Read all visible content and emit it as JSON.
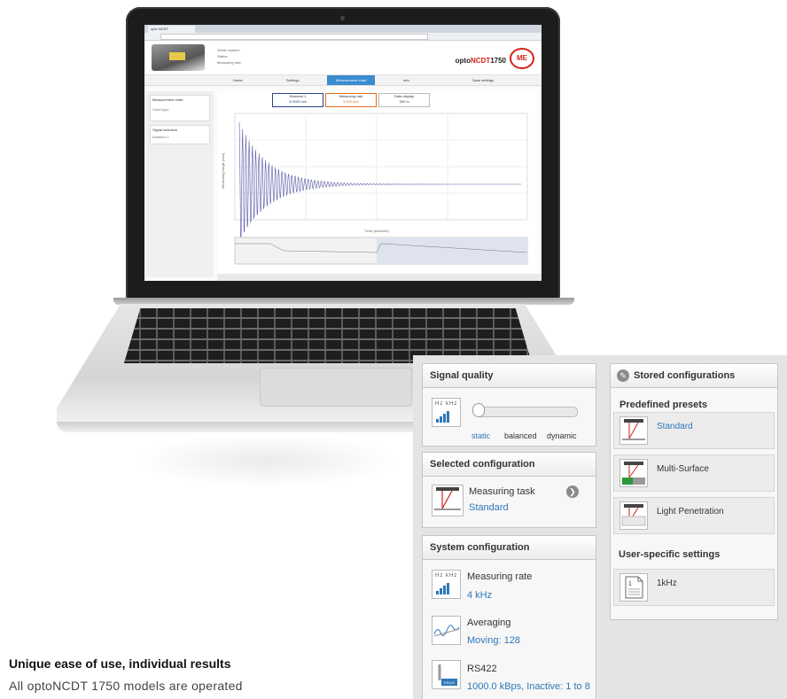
{
  "laptop_screen": {
    "tab_title": "opto NCDT",
    "brand": {
      "prefix": "opto",
      "accent": "NCDT",
      "model": "1750"
    },
    "logo_text": "ME",
    "meta": [
      "Serial number:",
      "Status:",
      "Measuring rate:"
    ],
    "nav": [
      "Home",
      "Settings",
      "Measurement chart",
      "Info"
    ],
    "save_label": "Save settings",
    "left_pane": {
      "chart_box": "Measurement chart",
      "chart_type": "Chart type",
      "signal_box": "Signal selection",
      "signal_item": "Distance 1"
    },
    "readouts": [
      {
        "label": "Distance 1",
        "value": "3.0000 mm"
      },
      {
        "label": "Measuring rate",
        "value": "4.000 kHz"
      },
      {
        "label": "Data display",
        "value": "300 /s"
      }
    ],
    "x_axis_label": "Time (seconds)",
    "y_axis_label": "Measuring range (mm)"
  },
  "signal_quality": {
    "title": "Signal quality",
    "icon_label": "Hz kHz",
    "options": [
      "static",
      "balanced",
      "dynamic"
    ],
    "level": 0
  },
  "selected_configuration": {
    "title": "Selected configuration",
    "item_label": "Measuring task",
    "item_value": "Standard"
  },
  "system_configuration": {
    "title": "System configuration",
    "items": [
      {
        "label": "Measuring rate",
        "value": "4 kHz",
        "icon": "hz-khz-bars-icon"
      },
      {
        "label": "Averaging",
        "value": "Moving: 128",
        "icon": "averaging-wave-icon"
      },
      {
        "label": "RS422",
        "value": "1000.0 kBps, Inactive: 1 to 8",
        "icon": "rs422-cable-icon"
      }
    ]
  },
  "stored_configurations": {
    "title": "Stored configurations",
    "predefined_title": "Predefined presets",
    "presets": [
      "Standard",
      "Multi-Surface",
      "Light Penetration"
    ],
    "user_title": "User-specific settings",
    "user_items": [
      "1kHz"
    ]
  },
  "text": {
    "heading": "Unique ease of use, individual results",
    "body": "All optoNCDT 1750 models are operated"
  },
  "colors": {
    "accent_blue": "#2d78b8",
    "brand_red": "#d4241c"
  }
}
